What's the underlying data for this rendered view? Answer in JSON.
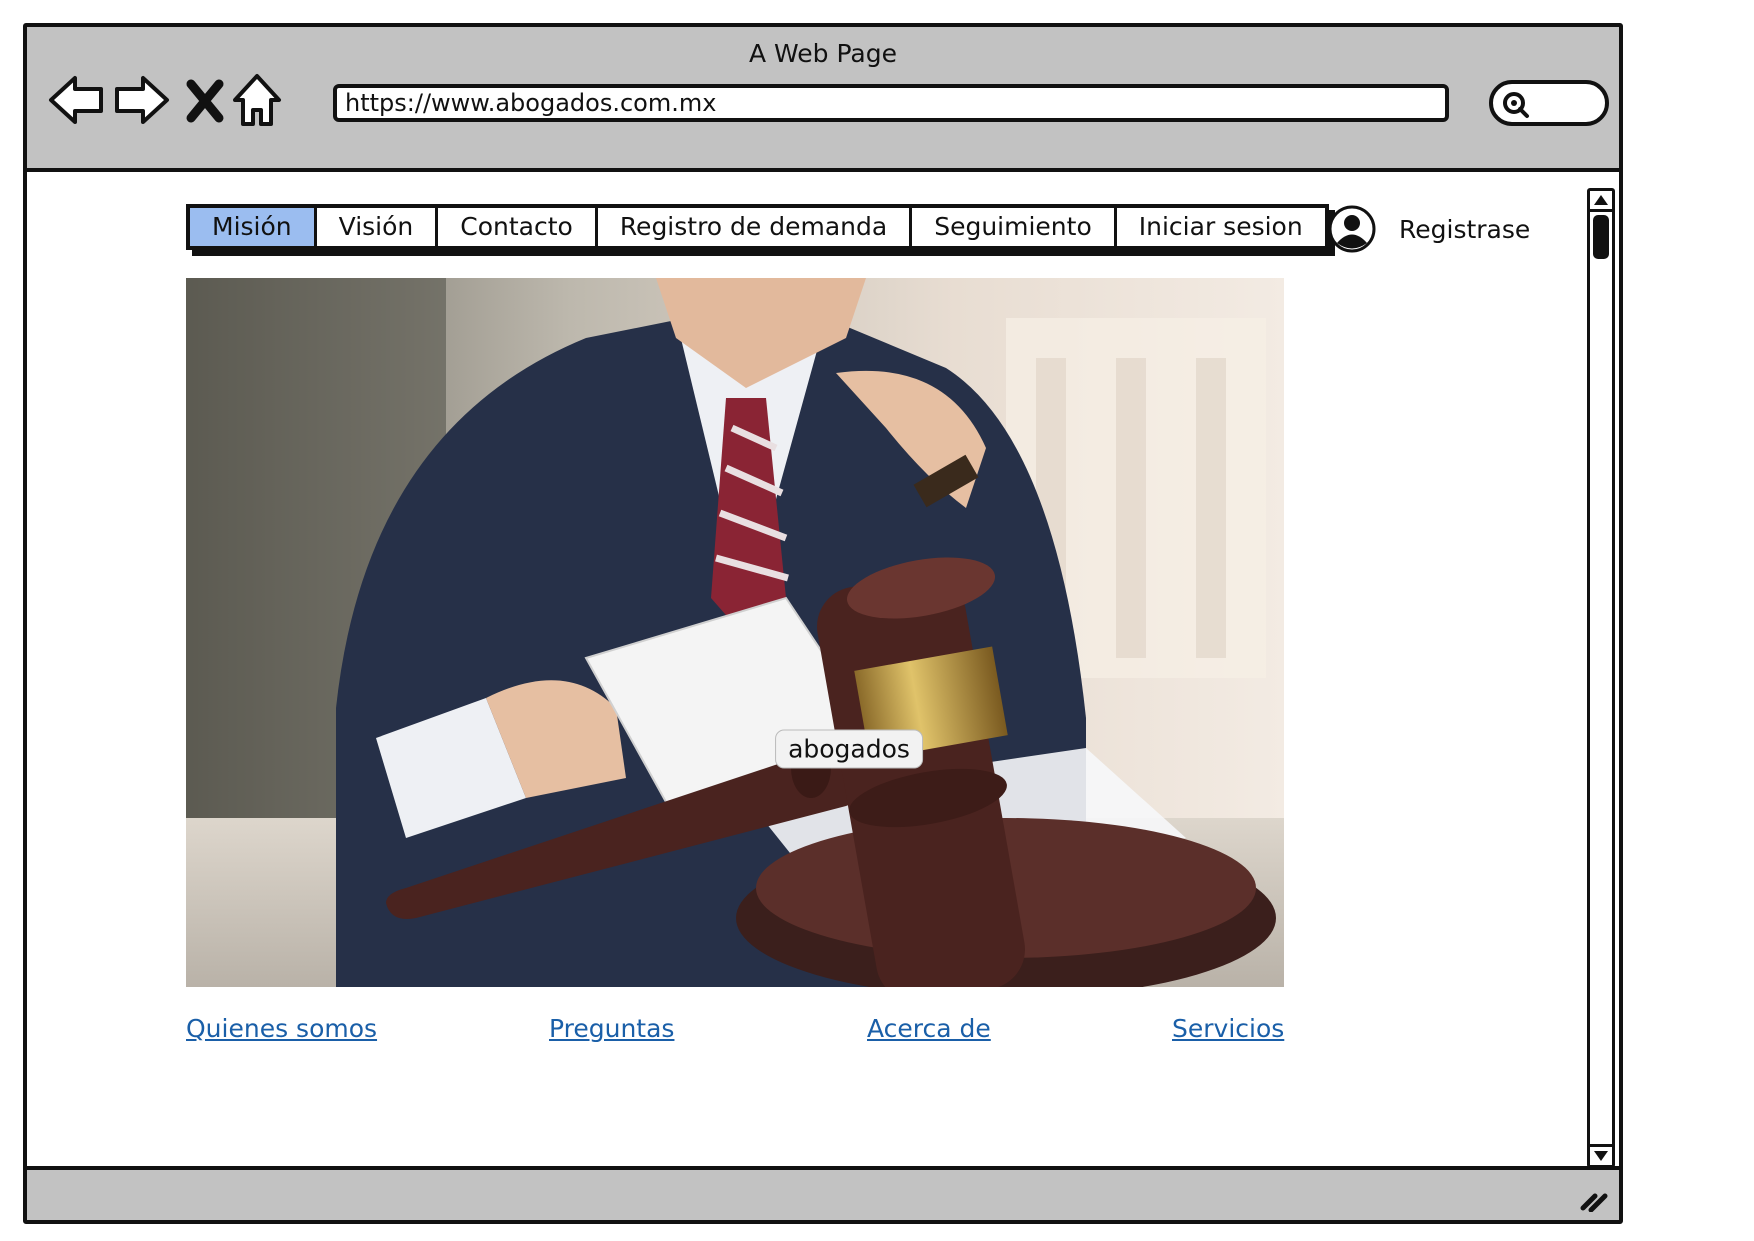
{
  "window": {
    "title": "A Web Page"
  },
  "toolbar": {
    "url": "https://www.abogados.com.mx",
    "icons": [
      "back-arrow-icon",
      "forward-arrow-icon",
      "close-icon",
      "home-icon",
      "search-icon"
    ]
  },
  "nav": {
    "tabs": [
      {
        "label": "Misión",
        "active": true
      },
      {
        "label": "Visión",
        "active": false
      },
      {
        "label": "Contacto",
        "active": false
      },
      {
        "label": "Registro de demanda",
        "active": false
      },
      {
        "label": "Seguimiento",
        "active": false
      },
      {
        "label": "Iniciar sesion",
        "active": false
      }
    ],
    "active_color": "#9bbdf0"
  },
  "user": {
    "label": "Registrase",
    "icon": "user-avatar-icon"
  },
  "hero": {
    "caption": "abogados"
  },
  "footer": {
    "links": [
      "Quienes somos",
      "Preguntas",
      "Acerca de",
      "Servicios"
    ],
    "link_color": "#1a5fa8"
  },
  "colors": {
    "chrome": "#c2c2c2",
    "outline": "#111111"
  }
}
